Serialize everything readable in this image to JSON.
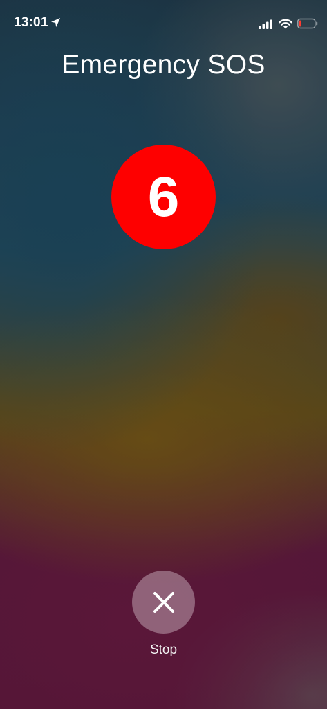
{
  "status_bar": {
    "time": "13:01",
    "icons": [
      "location-arrow-icon",
      "cellular-signal-icon",
      "wifi-icon",
      "battery-low-icon"
    ],
    "battery_level": 0.12,
    "battery_color": "#ff3b30"
  },
  "screen": {
    "title": "Emergency SOS",
    "countdown": "6",
    "countdown_color": "#fe0000",
    "stop_label": "Stop",
    "stop_icon": "close-icon"
  }
}
